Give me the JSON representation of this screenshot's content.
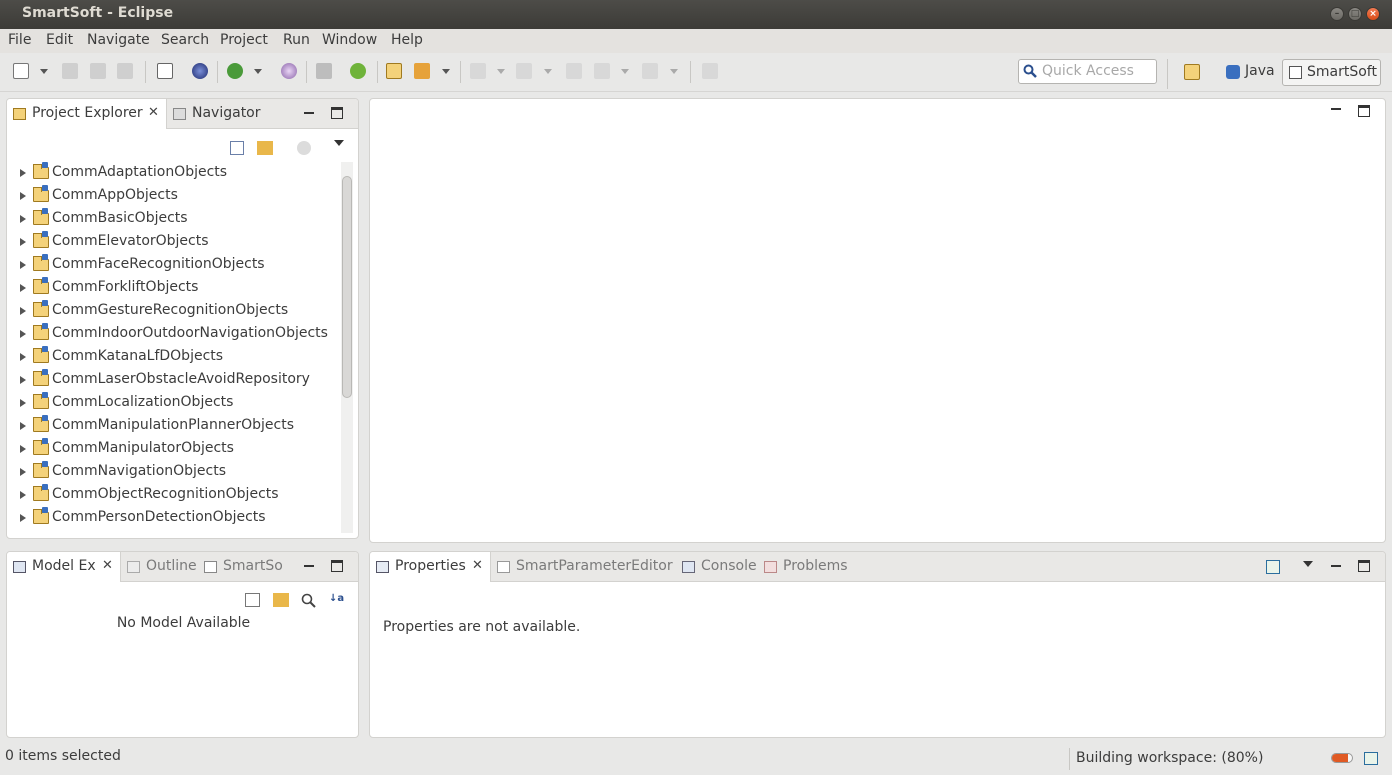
{
  "window": {
    "title": "SmartSoft - Eclipse"
  },
  "menubar": {
    "items": [
      "File",
      "Edit",
      "Navigate",
      "Search",
      "Project",
      "Run",
      "Window",
      "Help"
    ]
  },
  "toolbar": {
    "quick_access_placeholder": "Quick Access",
    "perspectives": [
      {
        "label": "Java",
        "active": false
      },
      {
        "label": "SmartSoft",
        "active": true
      }
    ]
  },
  "project_explorer_panel": {
    "tabs": [
      {
        "label": "Project Explorer",
        "active": true,
        "closable": true
      },
      {
        "label": "Navigator",
        "active": false,
        "closable": false
      }
    ],
    "projects": [
      "CommAdaptationObjects",
      "CommAppObjects",
      "CommBasicObjects",
      "CommElevatorObjects",
      "CommFaceRecognitionObjects",
      "CommForkliftObjects",
      "CommGestureRecognitionObjects",
      "CommIndoorOutdoorNavigationObjects",
      "CommKatanaLfDObjects",
      "CommLaserObstacleAvoidRepository",
      "CommLocalizationObjects",
      "CommManipulationPlannerObjects",
      "CommManipulatorObjects",
      "CommNavigationObjects",
      "CommObjectRecognitionObjects",
      "CommPersonDetectionObjects"
    ]
  },
  "model_panel": {
    "tabs": [
      {
        "label": "Model Ex",
        "active": true,
        "closable": true
      },
      {
        "label": "Outline",
        "active": false
      },
      {
        "label": "SmartSo",
        "active": false
      }
    ],
    "empty_message": "No Model Available"
  },
  "properties_panel": {
    "tabs": [
      {
        "label": "Properties",
        "active": true,
        "closable": true
      },
      {
        "label": "SmartParameterEditor",
        "active": false
      },
      {
        "label": "Console",
        "active": false
      },
      {
        "label": "Problems",
        "active": false
      }
    ],
    "empty_message": "Properties are not available."
  },
  "statusbar": {
    "selection": "0 items selected",
    "progress_text": "Building workspace: (80%)",
    "progress_fraction": 0.8
  },
  "colors": {
    "titlebar": "#3c3b37",
    "close_button": "#e05a24",
    "panel_border": "#d3d2cf",
    "folder_icon": "#f4d27a",
    "project_badge": "#3a6fbf"
  }
}
